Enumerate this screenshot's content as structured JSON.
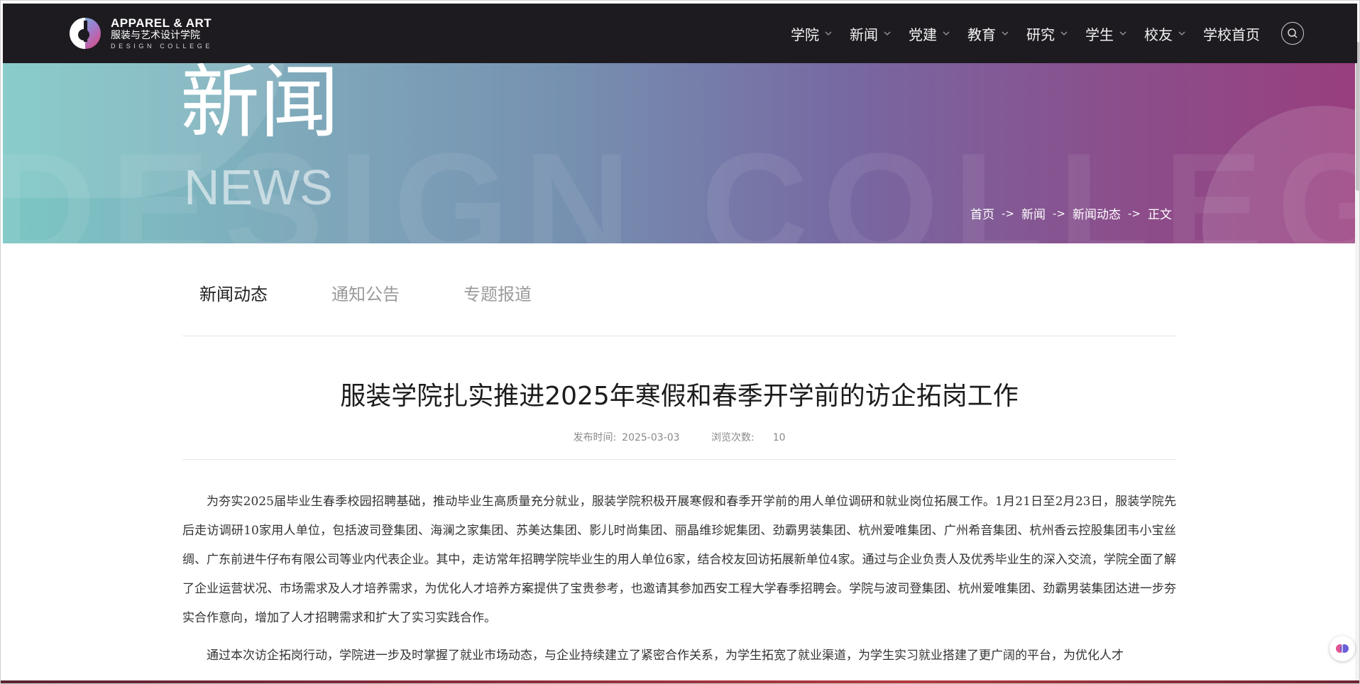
{
  "header": {
    "logo_en": "APPAREL & ART",
    "logo_cn": "服装与艺术设计学院",
    "logo_sub": "DESIGN COLLEGE",
    "nav": [
      {
        "label": "学院",
        "has_dropdown": true
      },
      {
        "label": "新闻",
        "has_dropdown": true
      },
      {
        "label": "党建",
        "has_dropdown": true
      },
      {
        "label": "教育",
        "has_dropdown": true
      },
      {
        "label": "研究",
        "has_dropdown": true
      },
      {
        "label": "学生",
        "has_dropdown": true
      },
      {
        "label": "校友",
        "has_dropdown": true
      }
    ],
    "home_label": "学校首页",
    "search_icon": "search-icon"
  },
  "banner": {
    "title": "新闻",
    "subtitle": "NEWS",
    "watermark": "DESIGN COLLEGE",
    "breadcrumb": [
      "首页",
      "新闻",
      "新闻动态",
      "正文"
    ],
    "separator": "->"
  },
  "tabs": [
    "新闻动态",
    "通知公告",
    "专题报道"
  ],
  "article": {
    "title": "服装学院扎实推进2025年寒假和春季开学前的访企拓岗工作",
    "publish_label": "发布时间:",
    "publish_date": "2025-03-03",
    "views_label": "浏览次数:",
    "views": "10",
    "paragraphs": [
      "为夯实2025届毕业生春季校园招聘基础，推动毕业生高质量充分就业，服装学院积极开展寒假和春季开学前的用人单位调研和就业岗位拓展工作。1月21日至2月23日，服装学院先后走访调研10家用人单位，包括波司登集团、海澜之家集团、苏美达集团、影儿时尚集团、丽晶维珍妮集团、劲霸男装集团、杭州爱唯集团、广州希音集团、杭州香云控股集团韦小宝丝绸、广东前进牛仔布有限公司等业内代表企业。其中，走访常年招聘学院毕业生的用人单位6家，结合校友回访拓展新单位4家。通过与企业负责人及优秀毕业生的深入交流，学院全面了解了企业运营状况、市场需求及人才培养需求，为优化人才培养方案提供了宝贵参考，也邀请其参加西安工程大学春季招聘会。学院与波司登集团、杭州爱唯集团、劲霸男装集团达进一步夯实合作意向，增加了人才招聘需求和扩大了实习实践合作。",
      "通过本次访企拓岗行动，学院进一步及时掌握了就业市场动态，与企业持续建立了紧密合作关系，为学生拓宽了就业渠道，为学生实习就业搭建了更广阔的平台，为优化人才"
    ]
  },
  "colors": {
    "header_bg": "#1d1b20",
    "banner_start": "#7cc7c5",
    "banner_end": "#993e7e"
  }
}
